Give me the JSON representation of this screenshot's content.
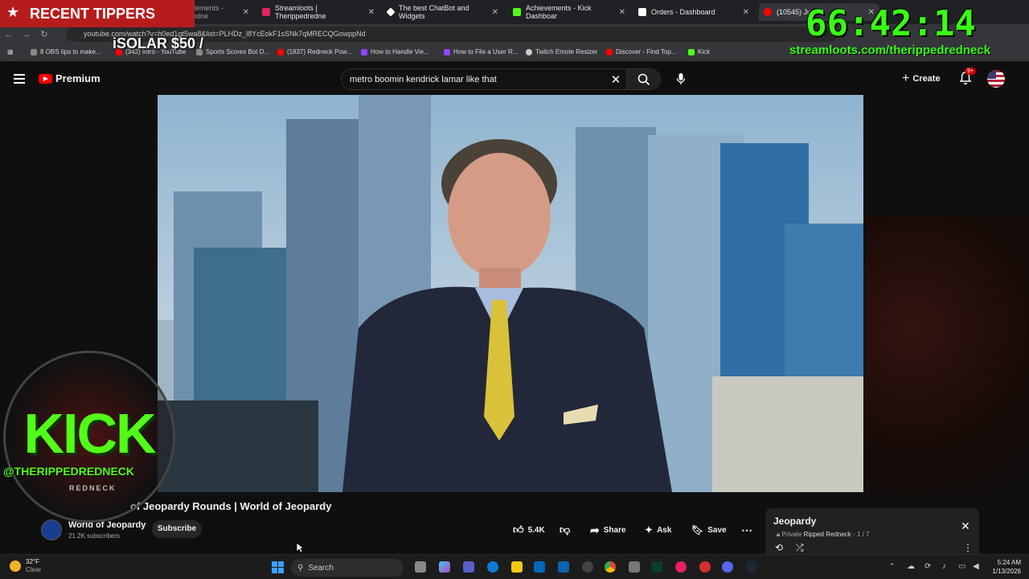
{
  "browser": {
    "tabs": [
      {
        "title": "StreamElements - ripppedredne",
        "icon": "streamelements-icon",
        "color": "#e0245e"
      },
      {
        "title": "Streamloots | Therippedredne",
        "icon": "streamloots-icon",
        "color": "#e0245e"
      },
      {
        "title": "The best ChatBot and Widgets",
        "icon": "diamond-icon",
        "color": "#ffffff"
      },
      {
        "title": "Achievements - Kick Dashboar",
        "icon": "kick-icon",
        "color": "#53fc18"
      },
      {
        "title": "Orders - Dashboard",
        "icon": "dashboard-icon",
        "color": "#ffffff"
      },
      {
        "title": "(10545) Just",
        "icon": "youtube-icon",
        "color": "#ff0000"
      }
    ],
    "url": "youtube.com/watch?v=h0ed1gt5wa8&list=PLHDz_l8YcEokF1sSNk7qMRECQGowppNd",
    "bookmarks": [
      {
        "label": "8 OBS tips to make...",
        "color": "#888888"
      },
      {
        "label": "(342) Intro - YouTube",
        "color": "#ff0000"
      },
      {
        "label": "Sports Scores Bot D...",
        "color": "#888888"
      },
      {
        "label": "(1837) Redneck Pow...",
        "color": "#ff0000"
      },
      {
        "label": "How to Handle Vie...",
        "color": "#9146ff"
      },
      {
        "label": "How to File a User R...",
        "color": "#9146ff"
      },
      {
        "label": "Twitch Emote Resizer",
        "color": "#cccccc"
      },
      {
        "label": "Discover - Find Top...",
        "color": "#ff0000"
      },
      {
        "label": "Kick",
        "color": "#53fc18"
      }
    ]
  },
  "youtube": {
    "logo_label": "Premium",
    "search_value": "metro boomin kendrick lamar like that",
    "create_label": "Create",
    "notifications_badge": "9+"
  },
  "video": {
    "title": "Jeopardy Rounds | World of Jeopardy",
    "title_visible": "of Jeopardy Rounds | World of Jeopardy",
    "channel_name": "World of Jeopardy",
    "subscribers": "21.2K subscribers",
    "subscribe_label": "Subscribe",
    "likes": "5.4K",
    "share_label": "Share",
    "ask_label": "Ask",
    "save_label": "Save"
  },
  "playlist": {
    "title": "Jeopardy",
    "privacy": "Private",
    "owner": "Ripped Redneck",
    "position": "1 / 7"
  },
  "overlays": {
    "recent_tippers": "RECENT TIPPERS",
    "solar_ticker": "iSOLAR $50 /",
    "timer": "66:42:14",
    "streamloots_url": "streamloots.com/therippedredneck",
    "kick_logo": "KICK",
    "kick_handle": "@THERIPPEDREDNECK",
    "kick_banner": "REDNECK"
  },
  "taskbar": {
    "temperature": "32°F",
    "condition": "Clear",
    "search_placeholder": "Search",
    "time": "5:24 AM",
    "date": "1/13/2026"
  },
  "colors": {
    "accent_green": "#53fc18",
    "youtube_red": "#ff0000",
    "tipper_red": "#b71c1c"
  }
}
